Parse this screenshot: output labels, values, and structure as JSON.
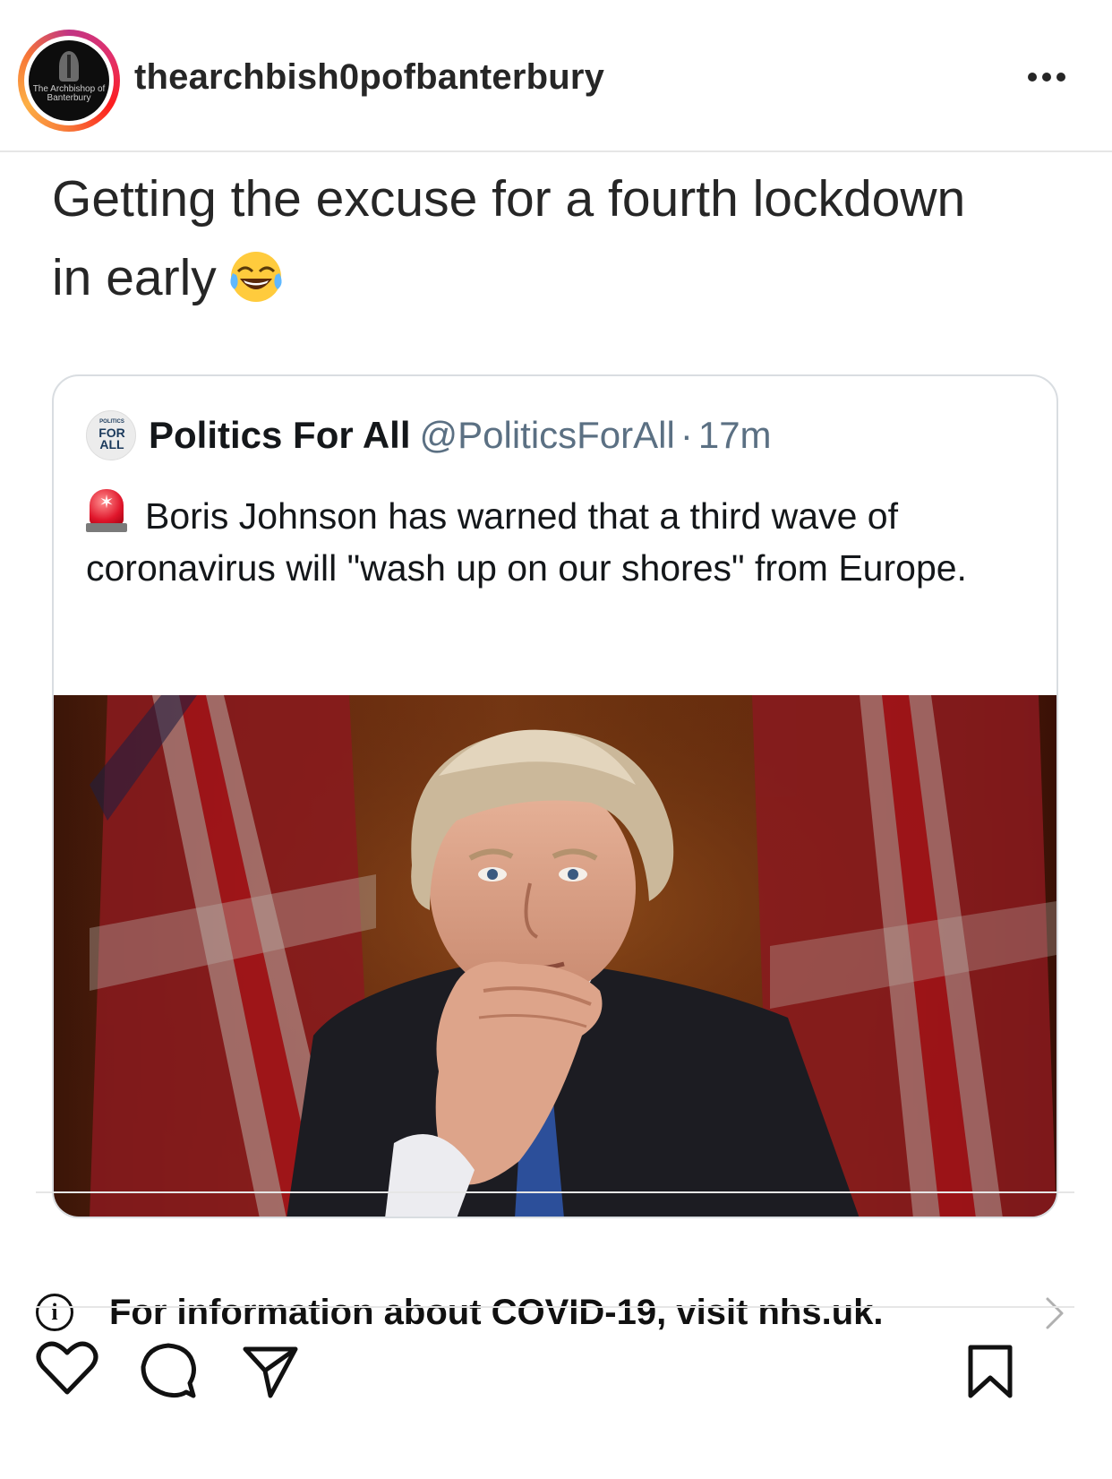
{
  "post": {
    "username": "thearchbish0pofbanterbury",
    "avatar_text_line1": "The Archbishop of",
    "avatar_text_line2": "Banterbury",
    "caption_line1": "Getting the excuse for a fourth lockdown",
    "caption_line2": "in early",
    "caption_emoji": "face-with-tears-of-joy-icon"
  },
  "quoted_tweet": {
    "avatar_text_top": "POLITICS",
    "avatar_text_mid": "FOR",
    "avatar_text_bottom": "ALL",
    "name": "Politics For All",
    "handle": "@PoliticsForAll",
    "separator": "·",
    "time": "17m",
    "text": "Boris Johnson has warned that a third wave of coronavirus will \"wash up on our shores\" from Europe.",
    "text_emoji": "police-siren-icon"
  },
  "info_bar": {
    "text": "For information about COVID-19, visit nhs.uk."
  },
  "icons": {
    "more": "more-options-icon",
    "like": "heart-icon",
    "comment": "comment-icon",
    "share": "send-icon",
    "save": "bookmark-icon",
    "info": "info-icon",
    "chevron": "chevron-right-icon"
  },
  "colors": {
    "text": "#262626",
    "tweet_secondary": "#5b7083",
    "card_border": "#d9dde1",
    "divider": "#e6e6e6"
  }
}
